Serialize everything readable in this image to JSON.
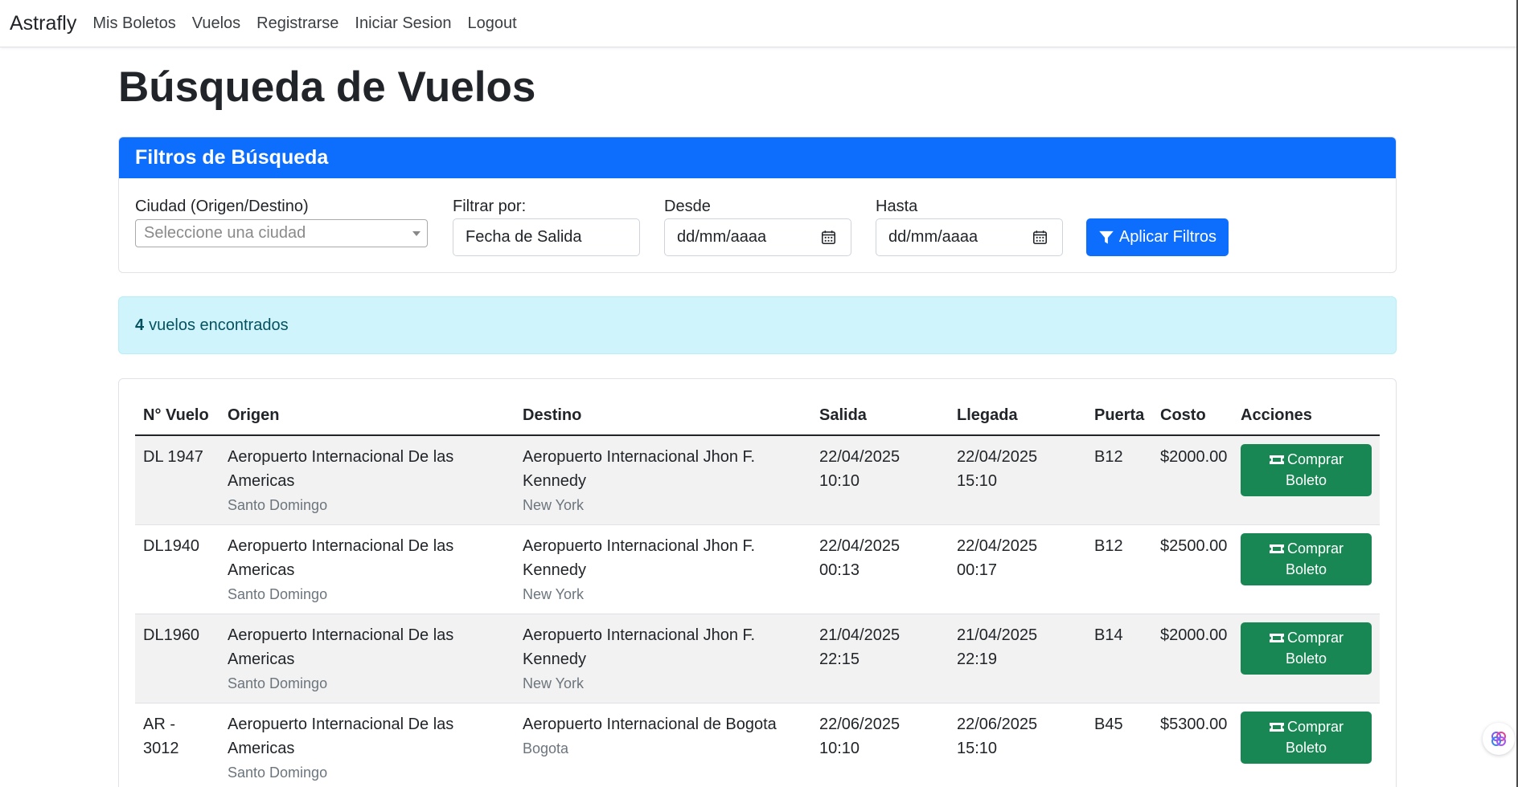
{
  "navbar": {
    "brand": "Astrafly",
    "links": [
      "Mis Boletos",
      "Vuelos",
      "Registrarse",
      "Iniciar Sesion",
      "Logout"
    ]
  },
  "page": {
    "title": "Búsqueda de Vuelos"
  },
  "filters": {
    "header": "Filtros de Búsqueda",
    "city_label": "Ciudad (Origen/Destino)",
    "city_placeholder": "Seleccione una ciudad",
    "filter_by_label": "Filtrar por:",
    "filter_by_value": "Fecha de Salida",
    "from_label": "Desde",
    "from_placeholder": "dd/mm/aaaa",
    "to_label": "Hasta",
    "to_placeholder": "dd/mm/aaaa",
    "apply_label": "Aplicar Filtros"
  },
  "results": {
    "count": "4",
    "text": "vuelos encontrados"
  },
  "table": {
    "headers": [
      "N° Vuelo",
      "Origen",
      "Destino",
      "Salida",
      "Llegada",
      "Puerta",
      "Costo",
      "Acciones"
    ],
    "buy_label_1": "Comprar",
    "buy_label_2": "Boleto",
    "rows": [
      {
        "flight_1": "DL 1947",
        "flight_2": "",
        "origin_1": "Aeropuerto Internacional De las",
        "origin_2": "Americas",
        "origin_city": "Santo Domingo",
        "dest_1": "Aeropuerto Internacional Jhon F.",
        "dest_2": "Kennedy",
        "dest_city": "New York",
        "dep_date": "22/04/2025",
        "dep_time": "10:10",
        "arr_date": "22/04/2025",
        "arr_time": "15:10",
        "gate": "B12",
        "cost": "$2000.00"
      },
      {
        "flight_1": "DL1940",
        "flight_2": "",
        "origin_1": "Aeropuerto Internacional De las",
        "origin_2": "Americas",
        "origin_city": "Santo Domingo",
        "dest_1": "Aeropuerto Internacional Jhon F.",
        "dest_2": "Kennedy",
        "dest_city": "New York",
        "dep_date": "22/04/2025",
        "dep_time": "00:13",
        "arr_date": "22/04/2025",
        "arr_time": "00:17",
        "gate": "B12",
        "cost": "$2500.00"
      },
      {
        "flight_1": "DL1960",
        "flight_2": "",
        "origin_1": "Aeropuerto Internacional De las",
        "origin_2": "Americas",
        "origin_city": "Santo Domingo",
        "dest_1": "Aeropuerto Internacional Jhon F.",
        "dest_2": "Kennedy",
        "dest_city": "New York",
        "dep_date": "21/04/2025",
        "dep_time": "22:15",
        "arr_date": "21/04/2025",
        "arr_time": "22:19",
        "gate": "B14",
        "cost": "$2000.00"
      },
      {
        "flight_1": "AR -",
        "flight_2": "3012",
        "origin_1": "Aeropuerto Internacional De las",
        "origin_2": "Americas",
        "origin_city": "Santo Domingo",
        "dest_1": "Aeropuerto Internacional de Bogota",
        "dest_2": "",
        "dest_city": "Bogota",
        "dep_date": "22/06/2025",
        "dep_time": "10:10",
        "arr_date": "22/06/2025",
        "arr_time": "15:10",
        "gate": "B45",
        "cost": "$5300.00"
      }
    ]
  },
  "colors": {
    "primary": "#0d6efd",
    "success": "#198754",
    "info_bg": "#cff4fc",
    "info_text": "#055160"
  }
}
